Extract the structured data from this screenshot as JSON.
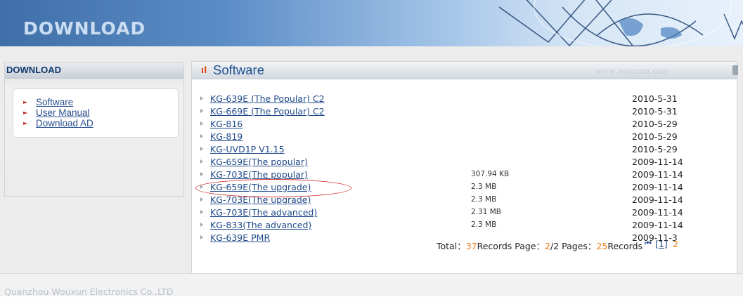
{
  "banner": {
    "title": "DOWNLOAD"
  },
  "left": {
    "header": "DOWNLOAD",
    "links": [
      "Software",
      "User Manual",
      "Download AD"
    ]
  },
  "right": {
    "title": "Software",
    "watermark": "www.wouxun.com"
  },
  "items": [
    {
      "name": "KG-639E (The Popular) C2",
      "size": "",
      "date": "2010-5-31"
    },
    {
      "name": "KG-669E (The Popular) C2",
      "size": "",
      "date": "2010-5-31"
    },
    {
      "name": "KG-816",
      "size": "",
      "date": "2010-5-29"
    },
    {
      "name": "KG-819",
      "size": "",
      "date": "2010-5-29"
    },
    {
      "name": "KG-UVD1P V1.15",
      "size": "",
      "date": "2010-5-29"
    },
    {
      "name": "KG-659E(The popular)",
      "size": "",
      "date": "2009-11-14"
    },
    {
      "name": "KG-703E(The popular)",
      "size": "307.94 KB",
      "date": "2009-11-14"
    },
    {
      "name": "KG-659E(The upgrade)",
      "size": "2.3 MB",
      "date": "2009-11-14"
    },
    {
      "name": "KG-703E(The upgrade)",
      "size": "2.3 MB",
      "date": "2009-11-14"
    },
    {
      "name": "KG-703E(The advanced)",
      "size": "2.31 MB",
      "date": "2009-11-14"
    },
    {
      "name": "KG-833(The advanced)",
      "size": "2.3 MB",
      "date": "2009-11-14"
    },
    {
      "name": "KG-639E PMR",
      "size": "",
      "date": "2009-11-3"
    }
  ],
  "pager": {
    "total_label": "Total：",
    "total": "37",
    "records_label": "Records Page：",
    "current": "2",
    "pages": "/2 Pages：",
    "per_page": "25",
    "per_page_label": "Records",
    "first_icon": "first-page-icon",
    "page1": "[1]",
    "page2": "2"
  },
  "footer": {
    "text": "Quanzhou Wouxun Electronics Co.,LTD"
  },
  "colors": {
    "accent": "#1c4f8e",
    "highlight": "#f07a14",
    "circle": "#d63333"
  }
}
